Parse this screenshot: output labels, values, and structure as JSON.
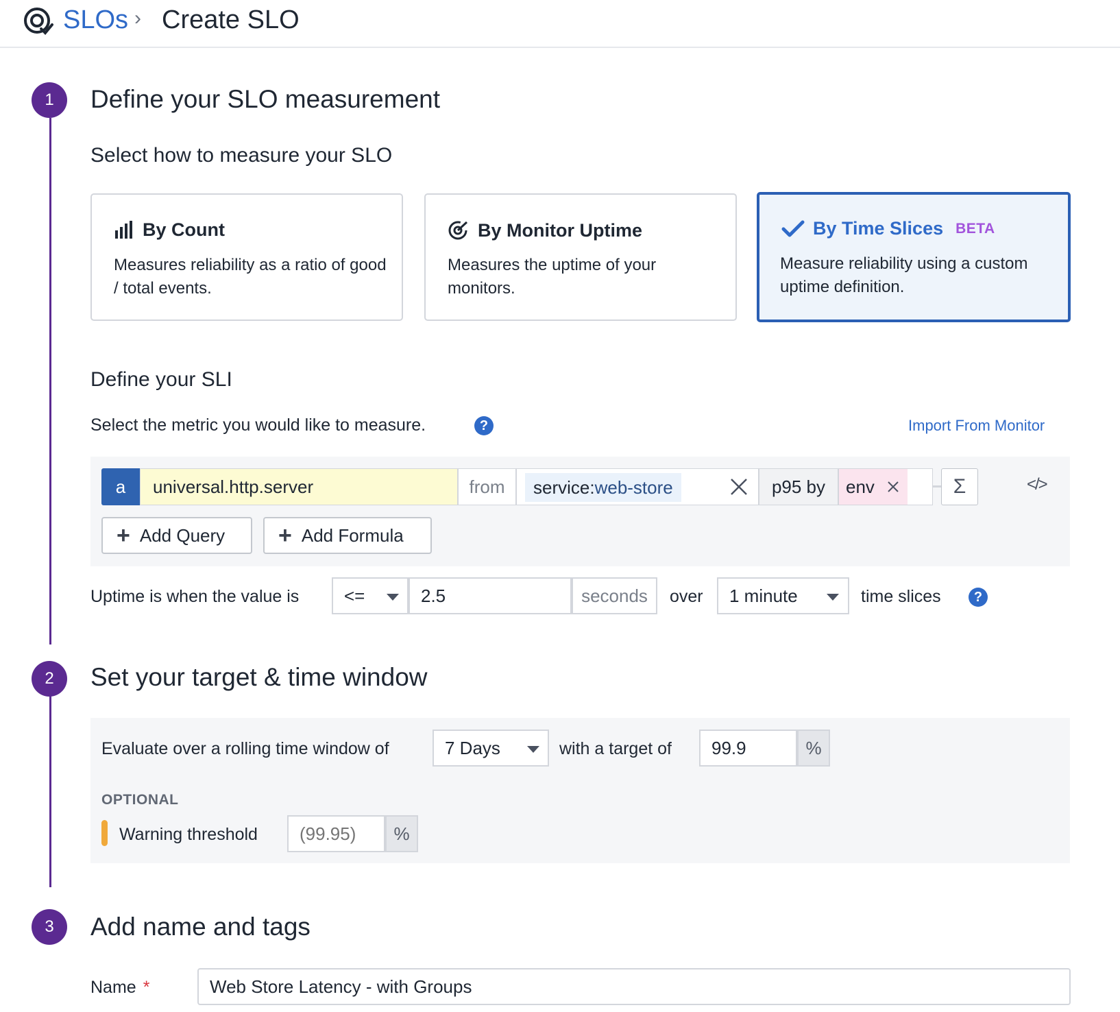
{
  "header": {
    "breadcrumb_root": "SLOs",
    "breadcrumb_separator": "›",
    "breadcrumb_current": "Create SLO"
  },
  "steps": [
    {
      "number": "1",
      "title": "Define your SLO measurement"
    },
    {
      "number": "2",
      "title": "Set your target & time window"
    },
    {
      "number": "3",
      "title": "Add name and tags"
    }
  ],
  "measurement": {
    "subtitle": "Select how to measure your SLO",
    "cards": [
      {
        "title": "By Count",
        "description": "Measures reliability as a ratio of good / total events.",
        "icon": "bar-chart-icon",
        "selected": false
      },
      {
        "title": "By Monitor Uptime",
        "description": "Measures the uptime of your monitors.",
        "icon": "monitor-target-icon",
        "selected": false
      },
      {
        "title": "By Time Slices",
        "badge": "BETA",
        "description": "Measure reliability using a custom uptime definition.",
        "icon": "check-icon",
        "selected": true
      }
    ]
  },
  "sli": {
    "title": "Define your SLI",
    "instruction": "Select the metric you would like to measure.",
    "import_link": "Import From Monitor",
    "query": {
      "letter": "a",
      "metric": "universal.http.server",
      "from_label": "from",
      "scope_key": "service:",
      "scope_value": "web-store",
      "aggregation": "p95 by",
      "group_by": "env",
      "sigma": "Σ",
      "code_toggle": "</>"
    },
    "add_query_label": "Add Query",
    "add_formula_label": "Add Formula",
    "uptime": {
      "prefix": "Uptime is when the value is",
      "comparator": "<=",
      "threshold": "2.5",
      "unit": "seconds",
      "over_label": "over",
      "slice_window": "1 minute",
      "suffix": "time slices"
    }
  },
  "target": {
    "window_prefix": "Evaluate over a rolling time window of",
    "window_value": "7 Days",
    "target_prefix": "with a target of",
    "target_value": "99.9",
    "percent": "%",
    "optional_label": "OPTIONAL",
    "warning_label": "Warning threshold",
    "warning_placeholder": "(99.95)"
  },
  "name_tags": {
    "name_label": "Name",
    "required_mark": "*",
    "name_value": "Web Store Latency - with Groups"
  },
  "colors": {
    "accent": "#2f6ac8",
    "step": "#5b2a91",
    "beta": "#a254dc",
    "warning": "#f0a93b"
  }
}
